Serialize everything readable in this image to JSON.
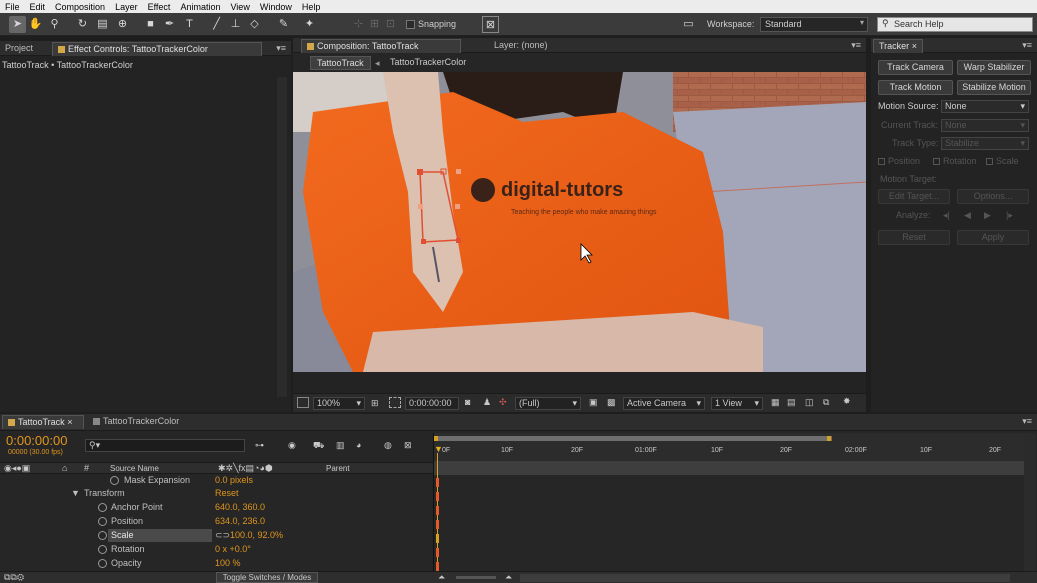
{
  "menu": [
    "File",
    "Edit",
    "Composition",
    "Layer",
    "Effect",
    "Animation",
    "View",
    "Window",
    "Help"
  ],
  "toolbar": {
    "snapping_label": "Snapping",
    "workspace_label": "Workspace:",
    "workspace_value": "Standard",
    "search_placeholder": "Search Help"
  },
  "left_panel": {
    "tabs": [
      {
        "label": "Project"
      },
      {
        "label": "Effect Controls: TattooTrackerColor"
      }
    ],
    "breadcrumb": "TattooTrack • TattooTrackerColor"
  },
  "comp_panel": {
    "tabs": [
      {
        "label": "Composition: TattooTrack"
      },
      {
        "label": "Layer: (none)"
      }
    ],
    "breadcrumbs": [
      "TattooTrack",
      "TattooTrackerColor"
    ],
    "frame_logo": "digital-tutors",
    "frame_tagline": "Teaching the people who make amazing things",
    "footer": {
      "zoom": "100%",
      "timecode": "0:00:00:00",
      "resolution": "(Full)",
      "camera": "Active Camera",
      "views": "1 View"
    }
  },
  "tracker": {
    "tab": "Tracker",
    "track_camera": "Track Camera",
    "warp_stabilizer": "Warp Stabilizer",
    "track_motion": "Track Motion",
    "stabilize_motion": "Stabilize Motion",
    "motion_source_label": "Motion Source:",
    "motion_source_value": "None",
    "current_track_label": "Current Track:",
    "current_track_value": "None",
    "track_type_label": "Track Type:",
    "track_type_value": "Stabilize",
    "position": "Position",
    "rotation": "Rotation",
    "scale": "Scale",
    "motion_target": "Motion Target:",
    "edit_target": "Edit Target...",
    "options": "Options...",
    "analyze": "Analyze:",
    "reset": "Reset",
    "apply": "Apply"
  },
  "timeline": {
    "tabs": [
      {
        "label": "TattooTrack"
      },
      {
        "label": "TattooTrackerColor"
      }
    ],
    "timecode": "0:00:00:00",
    "fps": "00000 (30.00 fps)",
    "columns": {
      "source": "Source Name",
      "parent": "Parent"
    },
    "rows": [
      {
        "name": "Mask Expansion",
        "value": "0.0 pixels"
      },
      {
        "name": "Transform",
        "value": "Reset"
      },
      {
        "name": "Anchor Point",
        "value": "640.0, 360.0"
      },
      {
        "name": "Position",
        "value": "634.0, 236.0"
      },
      {
        "name": "Scale",
        "value": "100.0, 92.0%"
      },
      {
        "name": "Rotation",
        "value": "0 x +0.0°"
      },
      {
        "name": "Opacity",
        "value": "100 %"
      }
    ],
    "ruler": [
      "0F",
      "10F",
      "20F",
      "01:00F",
      "10F",
      "20F",
      "02:00F",
      "10F",
      "20F"
    ],
    "toggle_label": "Toggle Switches / Modes"
  }
}
